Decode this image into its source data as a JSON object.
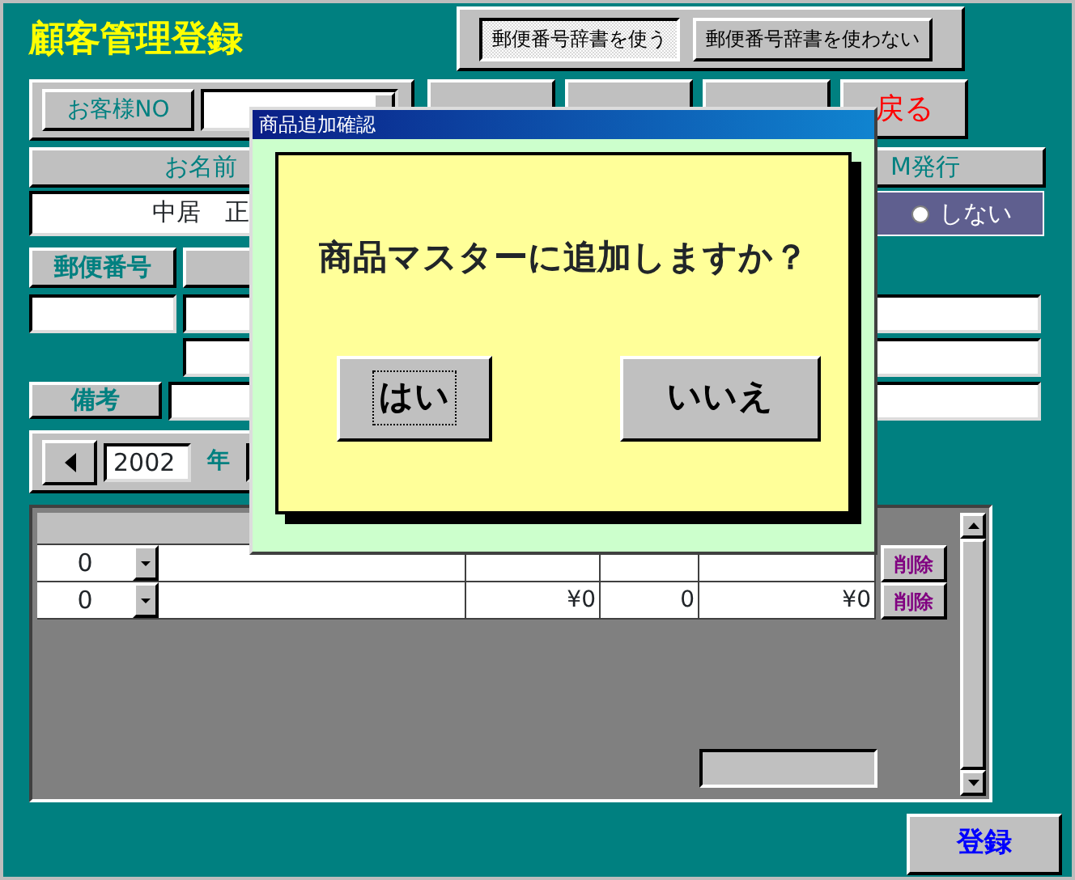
{
  "title": "顧客管理登録",
  "dictionary_buttons": [
    {
      "label": "郵便番号辞書を使う",
      "selected": true
    },
    {
      "label": "郵便番号辞書を使わない",
      "selected": false
    }
  ],
  "customer_no": {
    "label": "お客様NO"
  },
  "action_buttons": [
    {
      "label": "戻る",
      "kind": "back"
    }
  ],
  "name": {
    "label": "お名前",
    "value": "中居　正"
  },
  "dm": {
    "label": "M発行",
    "option": {
      "label": "しない",
      "selected": false
    }
  },
  "postal": {
    "label": "郵便番号"
  },
  "remarks": {
    "label": "備考"
  },
  "period": {
    "year": "2002",
    "unit": "年"
  },
  "items": {
    "rows": [
      {
        "code": "0",
        "delete": "削除"
      },
      {
        "code": "0",
        "price": "¥0",
        "quantity": "0",
        "total": "¥0",
        "delete": "削除"
      }
    ]
  },
  "dialog": {
    "title": "商品追加確認",
    "message": "商品マスターに追加しますか？",
    "buttons": [
      {
        "label": "はい",
        "focused": true
      },
      {
        "label": "いいえ",
        "focused": false
      }
    ]
  },
  "save_button": "登録"
}
